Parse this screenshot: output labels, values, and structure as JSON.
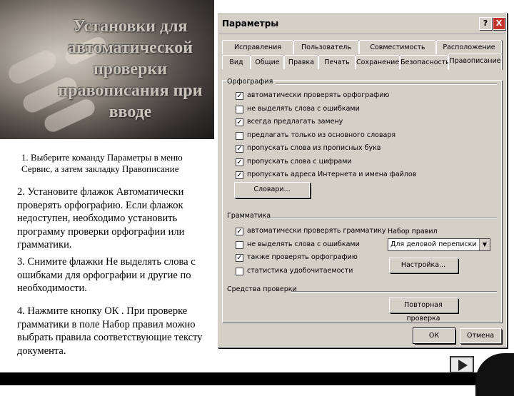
{
  "slide": {
    "title": "Установки для автоматической проверки правописания при вводе",
    "step1": "1. Выберите команду Параметры в меню Сервис, а затем закладку Правописание",
    "step2": "2. Установите флажок Автоматически проверять орфографию. Если флажок недоступен, необходимо установить программу проверки орфографии или грамматики.",
    "step3": "3. Снимите флажки Не выделять слова с ошибками для орфографии и другие по необходимости.",
    "step4": "4. Нажмите кнопку ОК . При проверке грамматики в поле Набор правил можно выбрать правила соответствующие тексту документа."
  },
  "dialog": {
    "title": "Параметры",
    "help": "?",
    "close": "X",
    "tabs_top": [
      "Исправления",
      "Пользователь",
      "Совместимость",
      "Расположение"
    ],
    "tabs_bottom": [
      "Вид",
      "Общие",
      "Правка",
      "Печать",
      "Сохранение",
      "Безопасность",
      "Правописание"
    ],
    "active_tab": "Правописание",
    "spelling": {
      "label": "Орфография",
      "options": [
        {
          "label": "автоматически проверять орфографию",
          "checked": true
        },
        {
          "label": "не выделять слова с ошибками",
          "checked": false
        },
        {
          "label": "всегда предлагать замену",
          "checked": true
        },
        {
          "label": "предлагать только из основного словаря",
          "checked": false
        },
        {
          "label": "пропускать слова из прописных букв",
          "checked": true
        },
        {
          "label": "пропускать слова с цифрами",
          "checked": true
        },
        {
          "label": "пропускать адреса Интернета и имена файлов",
          "checked": true
        }
      ],
      "dictionaries_button": "Словари..."
    },
    "grammar": {
      "label": "Грамматика",
      "options": [
        {
          "label": "автоматически проверять грамматику",
          "checked": true
        },
        {
          "label": "не выделять слова с ошибками",
          "checked": false
        },
        {
          "label": "также проверять орфографию",
          "checked": true
        },
        {
          "label": "статистика удобочитаемости",
          "checked": false
        }
      ],
      "ruleset_label": "Набор правил",
      "ruleset_value": "Для деловой переписки",
      "settings_button": "Настройка..."
    },
    "tools": {
      "label": "Средства проверки",
      "recheck_button": "Повторная проверка"
    },
    "ok_button": "ОК",
    "cancel_button": "Отмена"
  },
  "check_mark": "✓"
}
